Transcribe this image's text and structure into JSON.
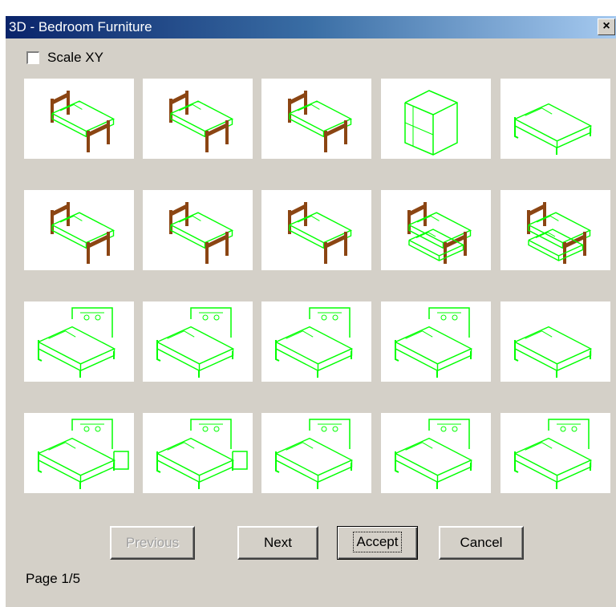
{
  "window": {
    "title": "3D - Bedroom Furniture",
    "close_label": "×"
  },
  "options": {
    "scale_xy_label": "Scale XY",
    "scale_xy_checked": false
  },
  "gallery": {
    "items": [
      {
        "kind": "bed-double-wood"
      },
      {
        "kind": "bed-double-wood"
      },
      {
        "kind": "bed-double-wood"
      },
      {
        "kind": "bunk-cabinet"
      },
      {
        "kind": "bed-single-plain"
      },
      {
        "kind": "bed-single-wood"
      },
      {
        "kind": "bed-single-wood"
      },
      {
        "kind": "bed-single-wood"
      },
      {
        "kind": "bunk-bed-wood"
      },
      {
        "kind": "crib-wood"
      },
      {
        "kind": "bed-double-headboard"
      },
      {
        "kind": "bed-double-headboard"
      },
      {
        "kind": "bunk-bed-green"
      },
      {
        "kind": "bed-single-headboard"
      },
      {
        "kind": "bed-double-plain"
      },
      {
        "kind": "bed-double-nightstand"
      },
      {
        "kind": "bed-double-nightstand"
      },
      {
        "kind": "bed-double-headboard"
      },
      {
        "kind": "bed-single-headboard"
      },
      {
        "kind": "bed-single-headboard"
      }
    ],
    "colors": {
      "wireframe": "#00ff00",
      "wood": "#8b4513"
    }
  },
  "buttons": {
    "previous": "Previous",
    "next": "Next",
    "accept": "Accept",
    "cancel": "Cancel"
  },
  "status": {
    "page": "Page 1/5"
  }
}
